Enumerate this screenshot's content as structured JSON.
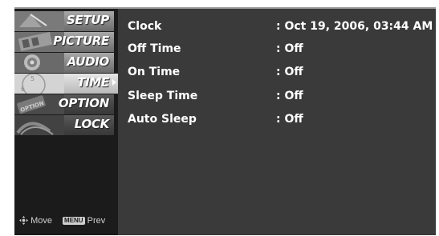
{
  "sidebar": {
    "items": [
      {
        "label": "SETUP",
        "icon": "satellite-icon"
      },
      {
        "label": "PICTURE",
        "icon": "film-icon"
      },
      {
        "label": "AUDIO",
        "icon": "speaker-icon"
      },
      {
        "label": "TIME",
        "icon": "clock-icon",
        "active": true
      },
      {
        "label": "OPTION",
        "icon": "option-icon"
      },
      {
        "label": "LOCK",
        "icon": "lock-icon"
      }
    ],
    "footer": {
      "move_label": "Move",
      "menu_key": "MENU",
      "prev_label": "Prev"
    }
  },
  "settings": [
    {
      "name": "Clock",
      "value": ": Oct 19, 2006, 03:44 AM"
    },
    {
      "name": "Off Time",
      "value": ": Off"
    },
    {
      "name": "On Time",
      "value": ": Off"
    },
    {
      "name": "Sleep Time",
      "value": ": Off"
    },
    {
      "name": "Auto Sleep",
      "value": ": Off"
    }
  ],
  "colors": {
    "panel": "#3a3a3a",
    "sidebar": "#1b1b1b",
    "text": "#ffffff"
  }
}
